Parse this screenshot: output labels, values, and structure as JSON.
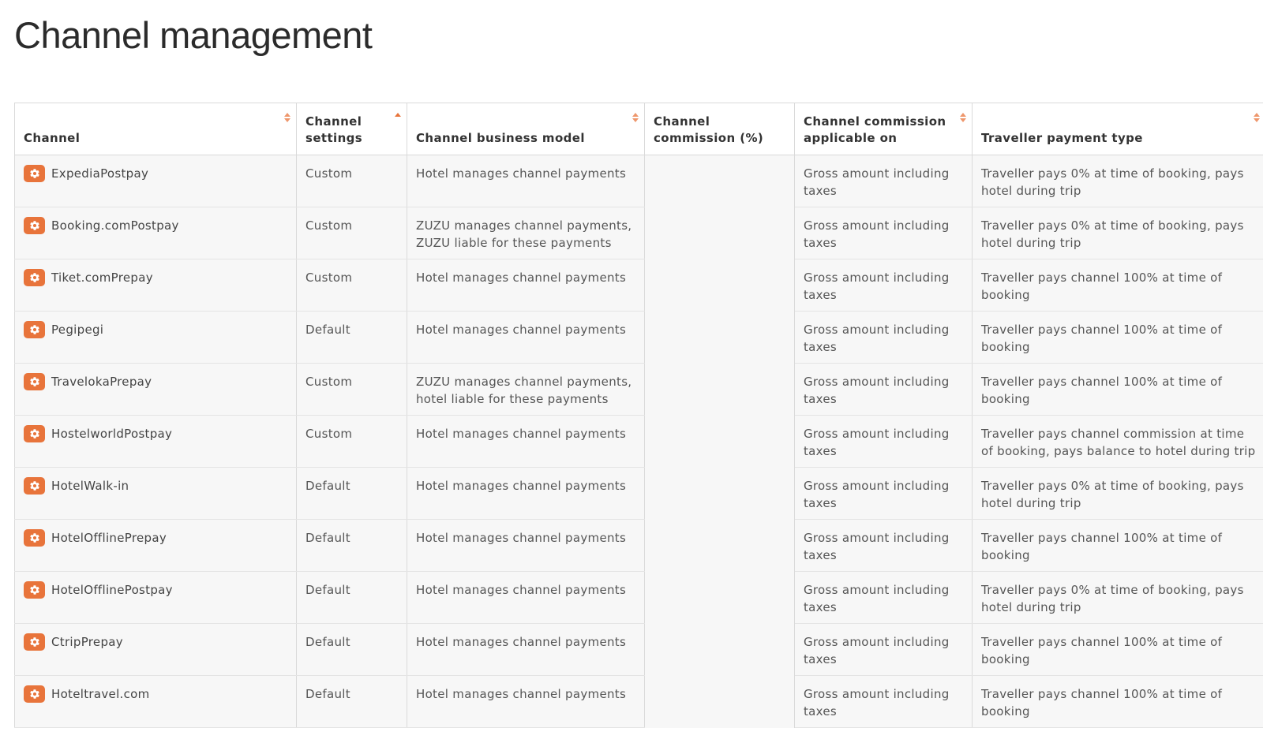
{
  "page": {
    "title": "Channel management"
  },
  "colors": {
    "accent": "#e8743b",
    "row_background": "#f7f7f7",
    "border": "#dadada"
  },
  "table": {
    "headers": {
      "channel": "Channel",
      "channel_settings": "Channel settings",
      "business_model": "Channel business model",
      "commission": "Channel commission (%)",
      "commission_applicable_on": "Channel commission applicable on",
      "payment_type": "Traveller payment type"
    },
    "sort_indicators": {
      "channel": "unsorted",
      "channel_settings": "ascending",
      "business_model": "unsorted",
      "commission_applicable_on": "unsorted",
      "payment_type": "unsorted"
    },
    "row_icon": "gear-icon",
    "rows": [
      {
        "channel": "ExpediaPostpay",
        "settings": "Custom",
        "business_model": "Hotel manages channel payments",
        "commission": "",
        "applicable_on": "Gross amount including taxes",
        "payment_type": "Traveller pays 0% at time of booking, pays hotel during trip"
      },
      {
        "channel": "Booking.comPostpay",
        "settings": "Custom",
        "business_model": "ZUZU manages channel payments, ZUZU liable for these payments",
        "commission": "",
        "applicable_on": "Gross amount including taxes",
        "payment_type": "Traveller pays 0% at time of booking, pays hotel during trip"
      },
      {
        "channel": "Tiket.comPrepay",
        "settings": "Custom",
        "business_model": "Hotel manages channel payments",
        "commission": "",
        "applicable_on": "Gross amount including taxes",
        "payment_type": "Traveller pays channel 100% at time of booking"
      },
      {
        "channel": "Pegipegi",
        "settings": "Default",
        "business_model": "Hotel manages channel payments",
        "commission": "",
        "applicable_on": "Gross amount including taxes",
        "payment_type": "Traveller pays channel 100% at time of booking"
      },
      {
        "channel": "TravelokaPrepay",
        "settings": "Custom",
        "business_model": "ZUZU manages channel payments, hotel liable for these payments",
        "commission": "",
        "applicable_on": "Gross amount including taxes",
        "payment_type": "Traveller pays channel 100% at time of booking"
      },
      {
        "channel": "HostelworldPostpay",
        "settings": "Custom",
        "business_model": "Hotel manages channel payments",
        "commission": "",
        "applicable_on": "Gross amount including taxes",
        "payment_type": "Traveller pays channel commission at time of booking, pays balance to hotel during trip"
      },
      {
        "channel": "HotelWalk-in",
        "settings": "Default",
        "business_model": "Hotel manages channel payments",
        "commission": "",
        "applicable_on": "Gross amount including taxes",
        "payment_type": "Traveller pays 0% at time of booking, pays hotel during trip"
      },
      {
        "channel": "HotelOfflinePrepay",
        "settings": "Default",
        "business_model": "Hotel manages channel payments",
        "commission": "",
        "applicable_on": "Gross amount including taxes",
        "payment_type": "Traveller pays channel 100% at time of booking"
      },
      {
        "channel": "HotelOfflinePostpay",
        "settings": "Default",
        "business_model": "Hotel manages channel payments",
        "commission": "",
        "applicable_on": "Gross amount including taxes",
        "payment_type": "Traveller pays 0% at time of booking, pays hotel during trip"
      },
      {
        "channel": "CtripPrepay",
        "settings": "Default",
        "business_model": "Hotel manages channel payments",
        "commission": "",
        "applicable_on": "Gross amount including taxes",
        "payment_type": "Traveller pays channel 100% at time of booking"
      },
      {
        "channel": "Hoteltravel.com",
        "settings": "Default",
        "business_model": "Hotel manages channel payments",
        "commission": "",
        "applicable_on": "Gross amount including taxes",
        "payment_type": "Traveller pays channel 100% at time of booking"
      }
    ]
  }
}
